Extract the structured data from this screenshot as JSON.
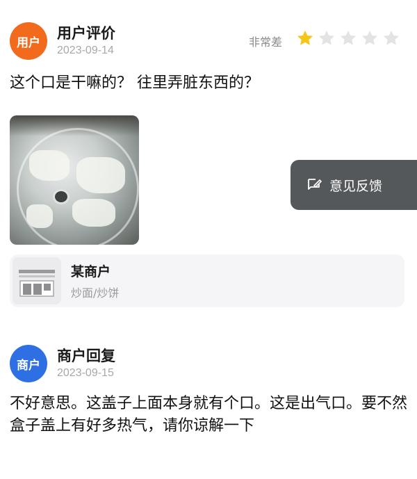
{
  "user_review": {
    "avatar_label": "用户",
    "name": "用户评价",
    "date": "2023-09-14",
    "rating_text": "非常差",
    "rating": 1,
    "max_rating": 5,
    "text": "这个口是干嘛的？ 往里弄脏东西的？"
  },
  "feedback_button": {
    "label": "意见反馈",
    "icon": "feedback-edit-icon"
  },
  "shop": {
    "name": "某商户",
    "category": "炒面/炒饼",
    "icon": "storefront-icon"
  },
  "merchant_reply": {
    "avatar_label": "商户",
    "name": "商户回复",
    "date": "2023-09-15",
    "text": "不好意思。这盖子上面本身就有个口。这是出气口。要不然盒子盖上有好多热气，请你谅解一下"
  },
  "colors": {
    "user_avatar": "#f26a1b",
    "merchant_avatar": "#2f6fe4",
    "star_filled": "#f5c518",
    "star_empty": "#e3e3e3"
  }
}
